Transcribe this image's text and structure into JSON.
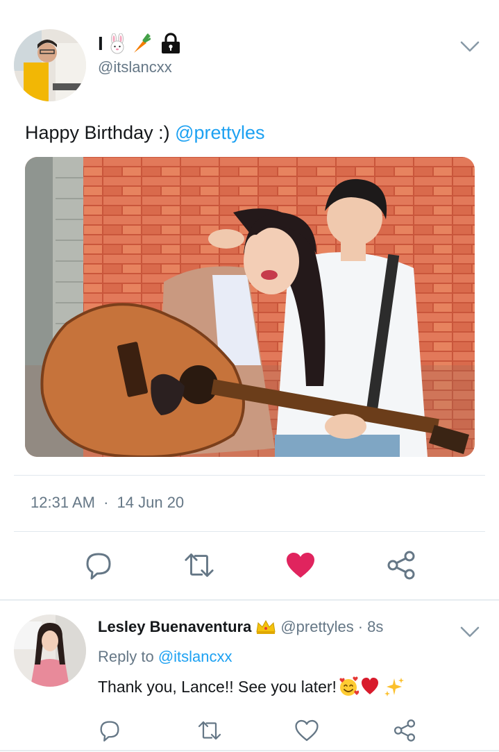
{
  "tweet": {
    "author_name": "I",
    "author_handle": "@itslancxx",
    "text": "Happy Birthday :) ",
    "mention": "@prettyles",
    "time": "12:31 AM",
    "date": "14 Jun 20",
    "liked": true
  },
  "reply": {
    "author_name": "Lesley Buenaventura",
    "author_handle": "@prettyles",
    "age": "8s",
    "reply_prefix": "Reply to ",
    "reply_to_handle": "@itslancxx",
    "text": "Thank you, Lance!! See you later!"
  },
  "colors": {
    "accent": "#1da1f2",
    "like": "#e0245e",
    "secondary_text": "#657786",
    "divider": "#e1e8ed"
  },
  "icons": [
    "rabbit-icon",
    "carrot-icon",
    "lock-icon",
    "chevron-down-icon",
    "reply-icon",
    "retweet-icon",
    "like-icon",
    "share-icon",
    "crown-icon",
    "smiling-face-with-hearts-icon",
    "heart-icon",
    "sparkles-icon"
  ]
}
